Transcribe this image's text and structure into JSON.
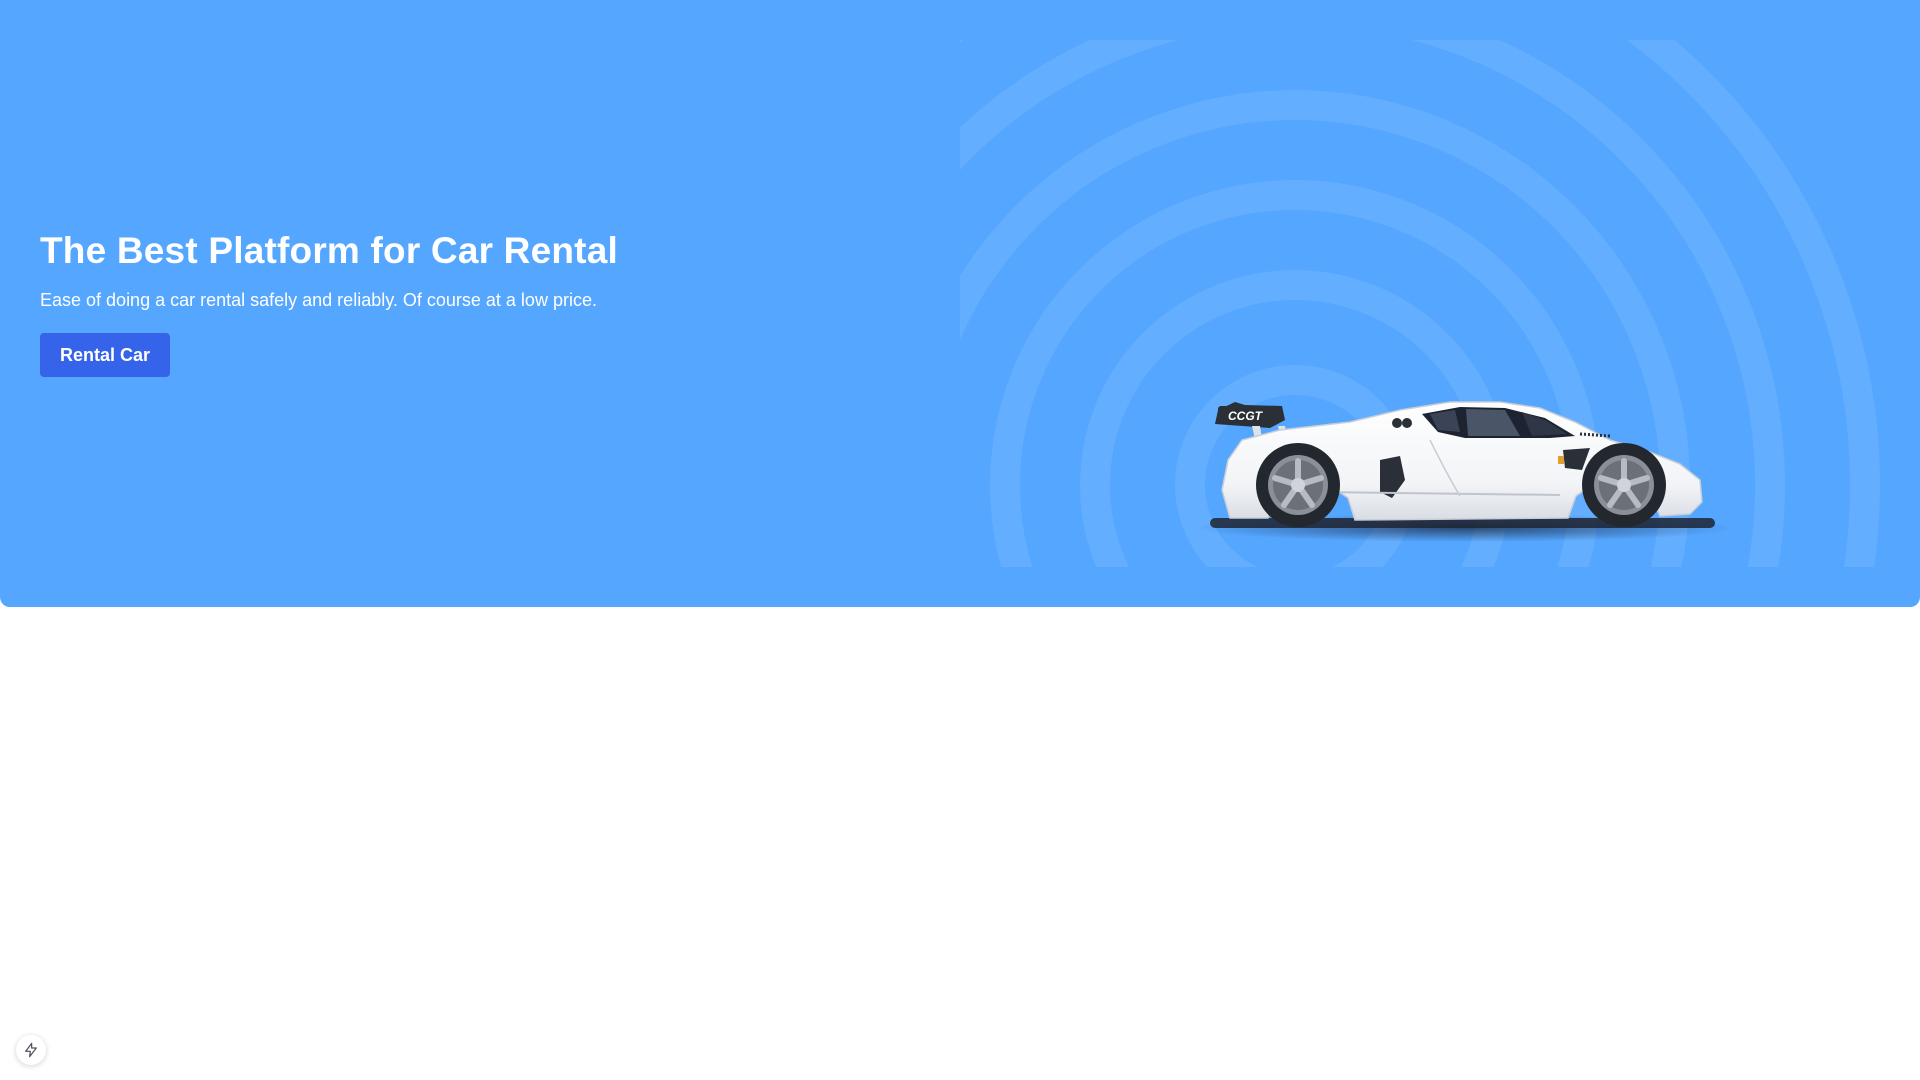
{
  "hero": {
    "title": "The Best Platform for Car Rental",
    "subtitle": "Ease of doing a car rental safely and reliably. Of course at a low price.",
    "button_label": "Rental Car",
    "car_badge": "CCGT"
  },
  "colors": {
    "hero_background": "#54a6ff",
    "button_background": "#3563e9",
    "text": "#ffffff"
  },
  "icons": {
    "floating_action": "lightning-icon",
    "hero_image": "white-sports-car"
  }
}
